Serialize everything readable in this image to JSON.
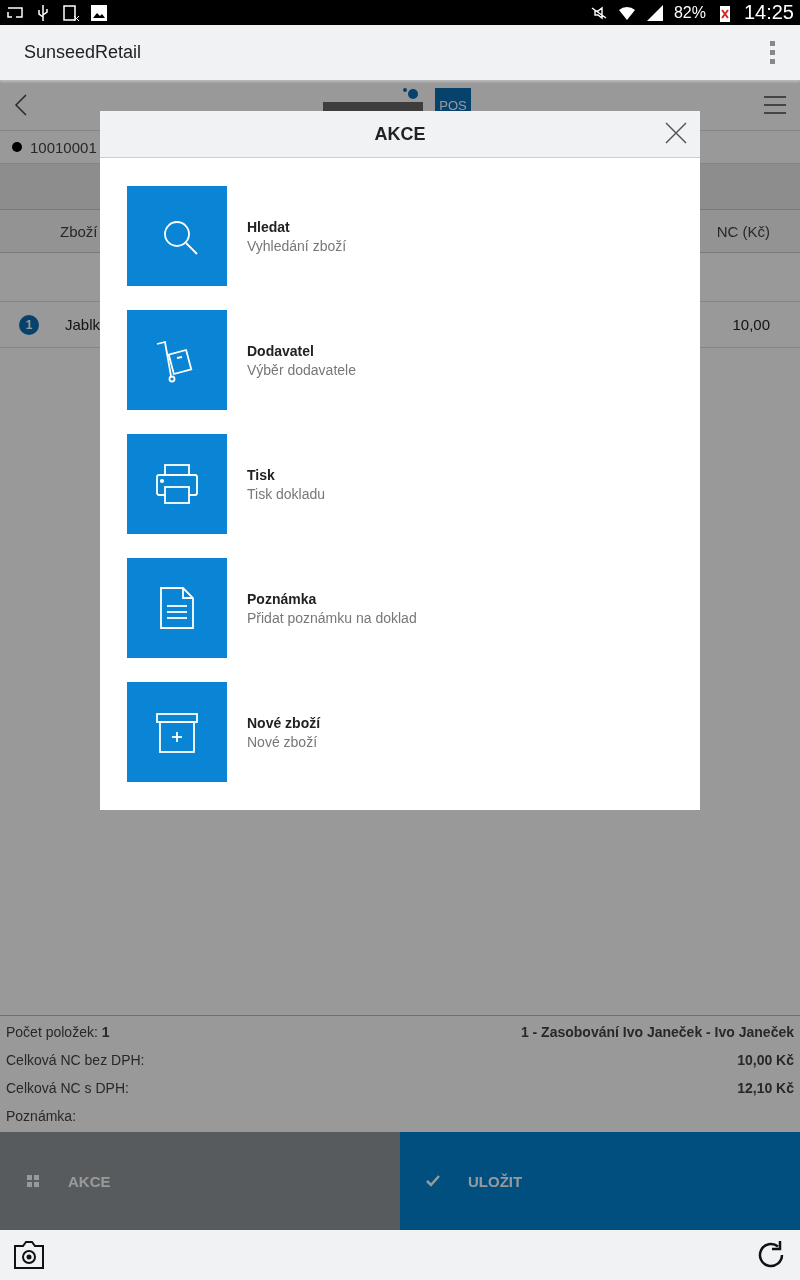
{
  "status_bar": {
    "battery": "82%",
    "time": "14:25"
  },
  "app_bar": {
    "title": "SunseedRetail"
  },
  "header": {
    "logo_badge": "POS"
  },
  "document": {
    "number": "10010001"
  },
  "table": {
    "columns": [
      "Zboží",
      "NC (Kč)"
    ],
    "rows": [
      {
        "index": "1",
        "name": "Jablk",
        "price": "10,00"
      }
    ]
  },
  "summary": [
    {
      "left": "Počet položek: **1**",
      "right": "1 - Zasobování Ivo Janeček - Ivo Janeček"
    },
    {
      "left": "Celková NC bez DPH:",
      "right": "10,00 Kč"
    },
    {
      "left": "Celková NC s DPH:",
      "right": "12,10 Kč"
    },
    {
      "left": "Poznámka:"
    }
  ],
  "actions": [
    {
      "kind": "grid",
      "label": "AKCE"
    },
    {
      "kind": "check",
      "label": "ULOŽIT"
    }
  ],
  "dialog": {
    "title": "AKCE",
    "items": [
      {
        "kind": "search",
        "title": "Hledat",
        "subtitle": "Vyhledání zboží"
      },
      {
        "kind": "cart",
        "title": "Dodavatel",
        "subtitle": "Výběr dodavatele"
      },
      {
        "kind": "printer",
        "title": "Tisk",
        "subtitle": "Tisk dokladu"
      },
      {
        "kind": "note",
        "title": "Poznámka",
        "subtitle": "Přidat poznámku na doklad"
      },
      {
        "kind": "box",
        "title": "Nové zboží",
        "subtitle": "Nové zboží"
      }
    ]
  }
}
